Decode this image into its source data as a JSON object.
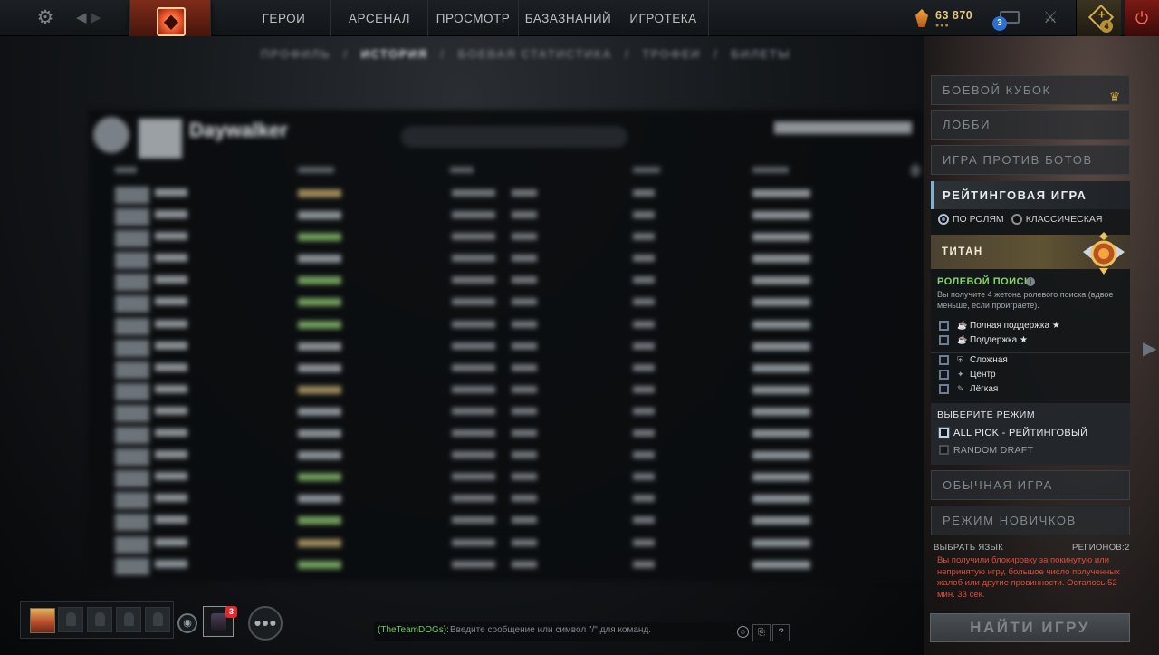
{
  "topbar": {
    "nav": [
      "ГЕРОИ",
      "АРСЕНАЛ",
      "ПРОСМОТР",
      "БАЗАЗНАНИЙ",
      "ИГРОТЕКА"
    ],
    "shards": "63 870",
    "mail_count": "3",
    "plus_count": "4"
  },
  "profile_subnav": [
    "ПРОФИЛЬ",
    "/",
    "ИСТОРИЯ",
    "/",
    "БОЕВАЯ СТАТИСТИКА",
    "/",
    "ТРОФЕИ",
    "/",
    "БИЛЕТЫ"
  ],
  "profile": {
    "name": "Daywalker",
    "rows": 18
  },
  "side": {
    "battle_cup": "БОЕВОЙ КУБОК",
    "lobby": "ЛОББИ",
    "vs_bots": "ИГРА ПРОТИВ БОТОВ",
    "ranked": "РЕЙТИНГОВАЯ ИГРА",
    "by_roles": "ПО РОЛЯМ",
    "classic": "КЛАССИЧЕСКАЯ",
    "rank_name": "ТИТАН",
    "role_search_title": "РОЛЕВОЙ ПОИСК",
    "role_search_desc": "Вы получите 4 жетона ролевого поиска (вдвое меньше, если проиграете).",
    "roles": [
      {
        "label": "Полная поддержка ★",
        "icon": "hard-support-icon"
      },
      {
        "label": "Поддержка ★",
        "icon": "soft-support-icon"
      },
      {
        "label": "Сложная",
        "icon": "offlane-icon"
      },
      {
        "label": "Центр",
        "icon": "mid-icon"
      },
      {
        "label": "Лёгкая",
        "icon": "safelane-icon"
      }
    ],
    "choose_mode": "ВЫБЕРИТЕ РЕЖИМ",
    "modes": [
      "ALL PICK - РЕЙТИНГОВЫЙ",
      "RANDOM DRAFT"
    ],
    "normal_game": "ОБЫЧНАЯ ИГРА",
    "newbie_mode": "РЕЖИМ НОВИЧКОВ",
    "choose_language": "ВЫБРАТЬ ЯЗЫК",
    "regions": "РЕГИОНОВ:2",
    "ban_text": "Вы получили блокировку за покинутую или непринятую игру, большое число полученных жалоб или другие провинности. Осталось 52 мин. 33 сек.",
    "find_game": "НАЙТИ ИГРУ"
  },
  "party": {
    "chest_badge": "3"
  },
  "chat": {
    "channel": "(TheTeamDOGs):",
    "placeholder": "Введите сообщение или символ \"/\" для команд."
  },
  "colors": {
    "accent_green": "#86d36b",
    "ban_red": "#e14b3b",
    "rank_gold": "#d0a444"
  }
}
